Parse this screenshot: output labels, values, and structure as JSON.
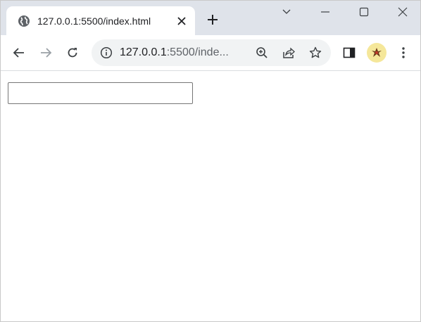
{
  "browser": {
    "tab": {
      "title": "127.0.0.1:5500/index.html",
      "favicon": "globe-icon",
      "close_icon": "close-icon"
    },
    "new_tab_icon": "plus-icon",
    "window_controls": [
      "chevron-down-icon",
      "minimize-icon",
      "maximize-icon",
      "close-icon"
    ]
  },
  "toolbar": {
    "nav_icons": [
      "back-arrow-icon",
      "forward-arrow-icon",
      "reload-icon"
    ],
    "address": {
      "host": "127.0.0.1",
      "rest": ":5500/inde...",
      "info_icon": "info-icon"
    },
    "omnibox_icons": [
      "zoom-icon",
      "share-icon",
      "star-icon"
    ],
    "right_icons": [
      "side-panel-icon",
      "profile-avatar",
      "more-menu-icon"
    ]
  },
  "page": {
    "input": {
      "value": "",
      "placeholder": ""
    }
  },
  "colors": {
    "tabstrip_bg": "#dfe3ea",
    "omnibox_bg": "#f1f3f4",
    "icon": "#5f6368",
    "text": "#202124",
    "avatar_bg": "#f5e79a"
  }
}
